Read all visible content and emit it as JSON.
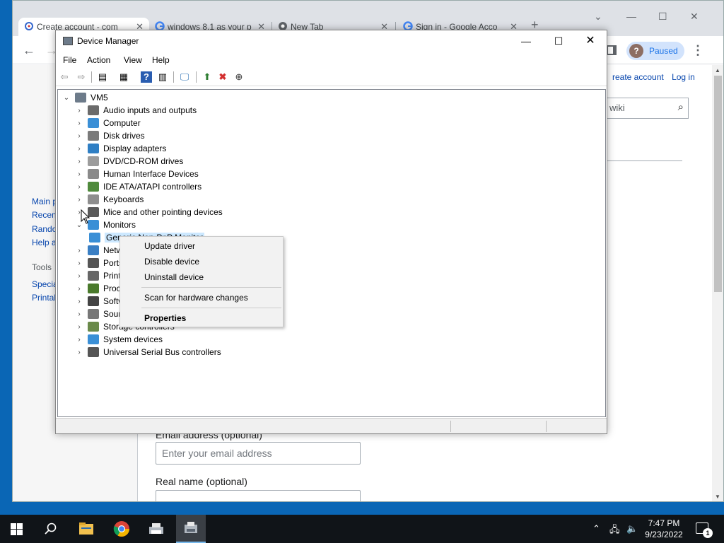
{
  "browser": {
    "tabs": [
      {
        "title": "Create account - com",
        "active": true
      },
      {
        "title": "windows 8.1 as your p"
      },
      {
        "title": "New Tab"
      },
      {
        "title": "Sign in - Google Acco"
      }
    ],
    "new_tab": "+",
    "profile_initial": "?",
    "profile_status": "Paused",
    "close_glyph": "✕"
  },
  "wiki": {
    "create_account": "reate account",
    "log_in": "Log in",
    "search_placeholder": "wiki",
    "sidebar": [
      "Main p",
      "Recen",
      "Rando",
      "Help a"
    ],
    "tools_heading": "Tools",
    "tools": [
      "Specia",
      "Printal"
    ],
    "email_label": "Email address (optional)",
    "email_placeholder": "Enter your email address",
    "realname_label": "Real name (optional)"
  },
  "device_manager": {
    "title": "Device Manager",
    "menu": [
      "File",
      "Action",
      "View",
      "Help"
    ],
    "root": "VM5",
    "categories": [
      {
        "label": "Audio inputs and outputs",
        "color": "#6b6b6b"
      },
      {
        "label": "Computer",
        "color": "#3a8fd6"
      },
      {
        "label": "Disk drives",
        "color": "#7a7a7a"
      },
      {
        "label": "Display adapters",
        "color": "#2f7fc4"
      },
      {
        "label": "DVD/CD-ROM drives",
        "color": "#9c9c9c"
      },
      {
        "label": "Human Interface Devices",
        "color": "#8a8a8a"
      },
      {
        "label": "IDE ATA/ATAPI controllers",
        "color": "#4f8a3c"
      },
      {
        "label": "Keyboards",
        "color": "#8e8e8e"
      },
      {
        "label": "Mice and other pointing devices",
        "color": "#5a5a5a"
      },
      {
        "label": "Monitors",
        "color": "#3a8fd6",
        "expanded": true
      },
      {
        "label": "Generic Non-PnP Monitor",
        "color": "#3a8fd6",
        "child": true
      },
      {
        "label": "Netw",
        "color": "#3a7fc4"
      },
      {
        "label": "Ports",
        "color": "#555555"
      },
      {
        "label": "Print",
        "color": "#666666"
      },
      {
        "label": "Proce",
        "color": "#4a7a2c"
      },
      {
        "label": "Softw",
        "color": "#444444"
      },
      {
        "label": "Soun",
        "color": "#777777"
      },
      {
        "label": "Storage controllers",
        "color": "#6a8a4a"
      },
      {
        "label": "System devices",
        "color": "#3a8fd6"
      },
      {
        "label": "Universal Serial Bus controllers",
        "color": "#555555"
      }
    ],
    "context_menu": {
      "items": [
        "Update driver",
        "Disable device",
        "Uninstall device",
        "Scan for hardware changes",
        "Properties"
      ]
    }
  },
  "taskbar": {
    "time": "7:47 PM",
    "date": "9/23/2022",
    "notifications": "1"
  }
}
